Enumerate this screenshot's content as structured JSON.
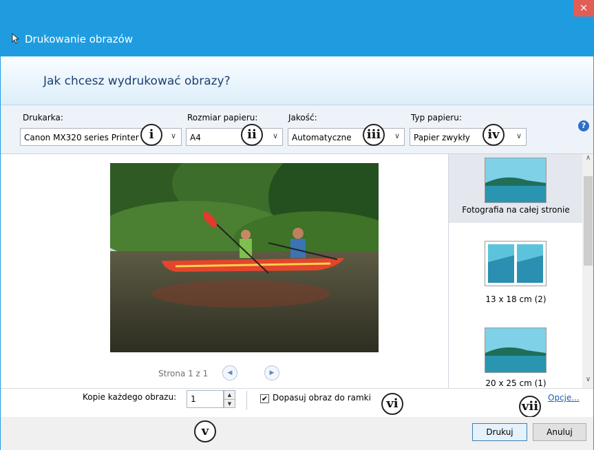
{
  "window": {
    "title": "Drukowanie obrazów",
    "close_glyph": "×",
    "accent_color": "#1f9ce0"
  },
  "header": {
    "question": "Jak chcesz wydrukować obrazy?"
  },
  "toolbar": {
    "printer_label": "Drukarka:",
    "printer_value": "Canon MX320 series Printer",
    "paper_size_label": "Rozmiar papieru:",
    "paper_size_value": "A4",
    "quality_label": "Jakość:",
    "quality_value": "Automatyczne",
    "paper_type_label": "Typ papieru:",
    "paper_type_value": "Papier zwykły",
    "help_glyph": "?",
    "chevron_icon": "chevron-down-icon"
  },
  "preview": {
    "page_text": "Strona 1 z 1",
    "prev_icon": "previous-page-icon",
    "next_icon": "next-page-icon"
  },
  "layouts": [
    {
      "label": "Fotografia na całej stronie",
      "selected": true
    },
    {
      "label": "13 x 18 cm (2)",
      "selected": false
    },
    {
      "label": "20 x 25 cm (1)",
      "selected": false
    }
  ],
  "options": {
    "copies_label": "Kopie każdego obrazu:",
    "copies_value": "1",
    "fit_label": "Dopasuj obraz do ramki",
    "fit_checked": true,
    "options_link": "Opcje..."
  },
  "footer": {
    "print_button": "Drukuj",
    "cancel_button": "Anuluj"
  },
  "callouts": [
    "i",
    "ii",
    "iii",
    "iv",
    "v",
    "vi",
    "vii"
  ]
}
